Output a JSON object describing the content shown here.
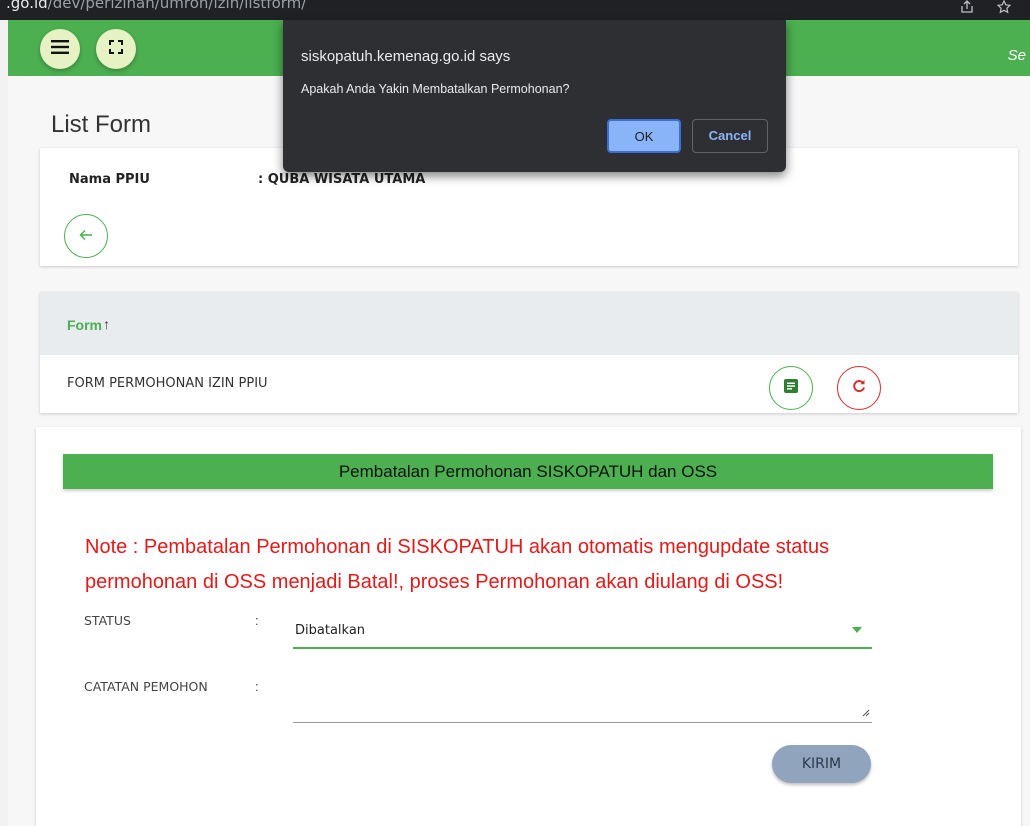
{
  "browser": {
    "url_domain": ".go.id",
    "url_path": "/dev/perizinan/umroh/izin/listform/"
  },
  "header": {
    "search_text": "Se"
  },
  "page": {
    "title": "List Form"
  },
  "ppiu": {
    "label": "Nama PPIU",
    "value": ": QUBA WISATA UTAMA"
  },
  "table": {
    "column_header": "Form",
    "sort_arrow": "↑",
    "rows": [
      {
        "name": "FORM PERMOHONAN IZIN PPIU"
      }
    ]
  },
  "cancel_form": {
    "banner": "Pembatalan Permohonan SISKOPATUH dan OSS",
    "note": "Note : Pembatalan Permohonan di SISKOPATUH akan otomatis mengupdate status permohonan di OSS menjadi Batal!, proses Permohonan akan diulang di OSS!",
    "status_label": "STATUS",
    "status_value": "Dibatalkan",
    "catatan_label": "CATATAN PEMOHON",
    "colon": ":",
    "submit_label": "KIRIM"
  },
  "dialog": {
    "title": "siskopatuh.kemenag.go.id says",
    "message": "Apakah Anda Yakin Membatalkan Permohonan?",
    "ok_label": "OK",
    "cancel_label": "Cancel"
  },
  "colors": {
    "primary_green": "#4caf50",
    "danger_red": "#d32f2f",
    "note_red": "#e21a1a",
    "dialog_bg": "#2e2f33",
    "dialog_accent": "#8ab4f8"
  },
  "icons": [
    "menu-icon",
    "fullscreen-icon",
    "arrow-left-icon",
    "document-list-icon",
    "refresh-icon",
    "share-icon",
    "star-icon"
  ]
}
